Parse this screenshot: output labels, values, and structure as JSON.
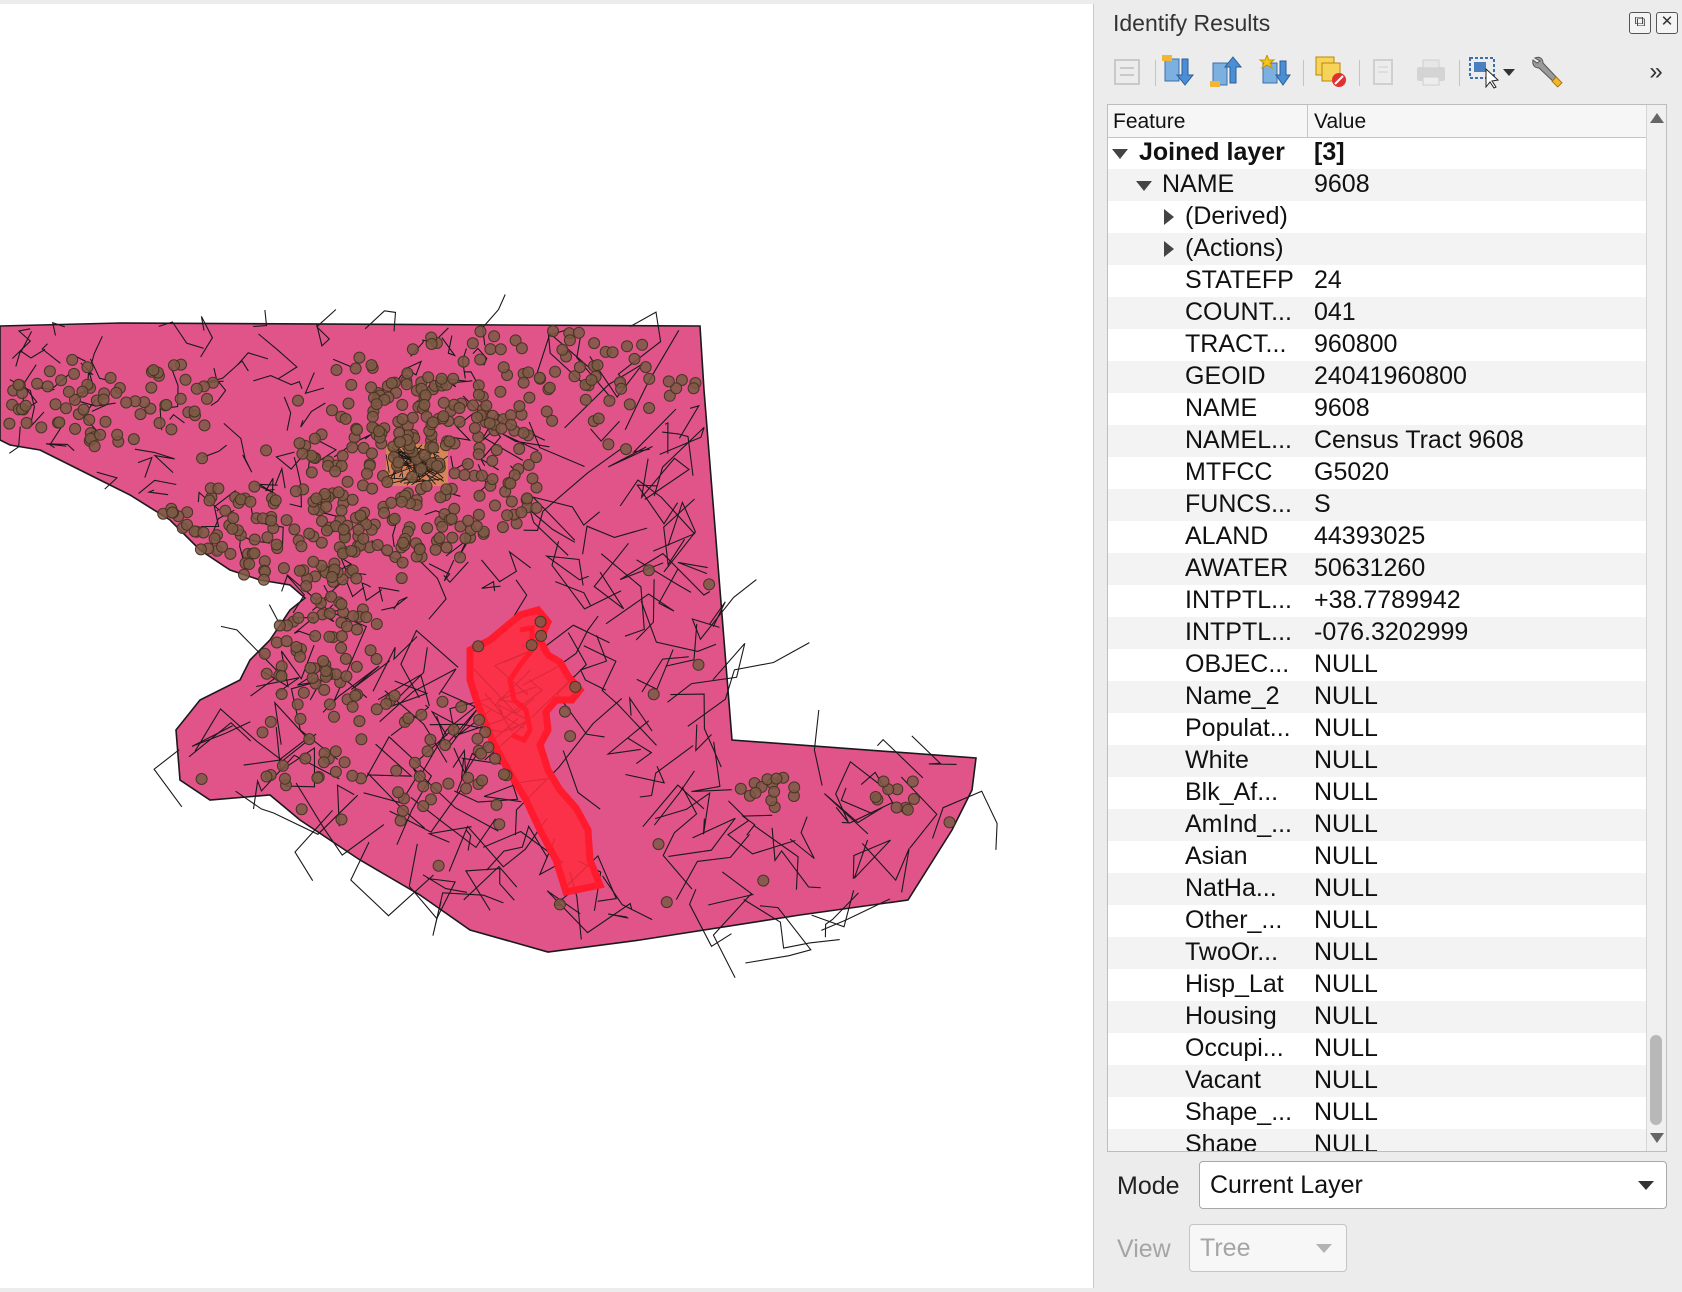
{
  "panel": {
    "title": "Identify Results",
    "dock_float_glyph": "⧉",
    "dock_close_glyph": "✕",
    "toolbar_overflow": "»"
  },
  "tree": {
    "headers": {
      "feature": "Feature",
      "value": "Value"
    },
    "layer": {
      "label": "Joined layer",
      "count": "[3]"
    },
    "feature_node": {
      "label": "NAME",
      "value": "9608"
    },
    "derived_label": "(Derived)",
    "actions_label": "(Actions)",
    "attributes": [
      {
        "field": "STATEFP",
        "value": "24"
      },
      {
        "field": "COUNT...",
        "value": "041"
      },
      {
        "field": "TRACT...",
        "value": "960800"
      },
      {
        "field": "GEOID",
        "value": "24041960800"
      },
      {
        "field": "NAME",
        "value": "9608"
      },
      {
        "field": "NAMEL...",
        "value": "Census Tract 9608"
      },
      {
        "field": "MTFCC",
        "value": "G5020"
      },
      {
        "field": "FUNCS...",
        "value": "S"
      },
      {
        "field": "ALAND",
        "value": "44393025"
      },
      {
        "field": "AWATER",
        "value": "50631260"
      },
      {
        "field": "INTPTL...",
        "value": "+38.7789942"
      },
      {
        "field": "INTPTL...",
        "value": "-076.3202999"
      },
      {
        "field": "OBJEC...",
        "value": "NULL"
      },
      {
        "field": "Name_2",
        "value": "NULL"
      },
      {
        "field": "Populat...",
        "value": "NULL"
      },
      {
        "field": "White",
        "value": "NULL"
      },
      {
        "field": "Blk_Af...",
        "value": "NULL"
      },
      {
        "field": "AmInd_...",
        "value": "NULL"
      },
      {
        "field": "Asian",
        "value": "NULL"
      },
      {
        "field": "NatHa...",
        "value": "NULL"
      },
      {
        "field": "Other_...",
        "value": "NULL"
      },
      {
        "field": "TwoOr...",
        "value": "NULL"
      },
      {
        "field": "Hisp_Lat",
        "value": "NULL"
      },
      {
        "field": "Housing",
        "value": "NULL"
      },
      {
        "field": "Occupi...",
        "value": "NULL"
      },
      {
        "field": "Vacant",
        "value": "NULL"
      },
      {
        "field": "Shape_...",
        "value": "NULL"
      },
      {
        "field": "Shape",
        "value": "NULL"
      }
    ]
  },
  "mode": {
    "label": "Mode",
    "value": "Current Layer"
  },
  "view": {
    "label": "View",
    "value": "Tree"
  },
  "map": {
    "fill_color": "#e0548a",
    "highlight_color": "#ff1a2e",
    "point_color": "#7a5a44",
    "background": "#ffffff"
  }
}
